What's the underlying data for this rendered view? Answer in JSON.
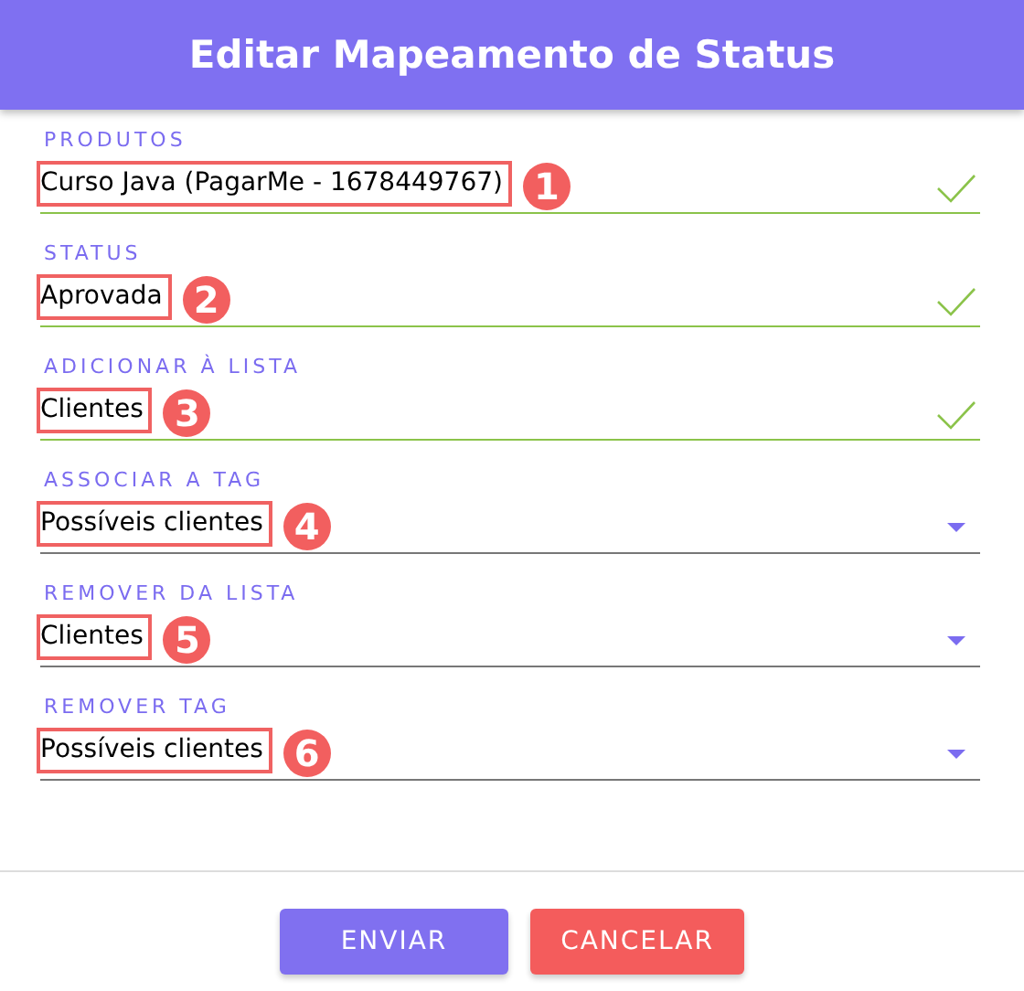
{
  "dialog": {
    "title": "Editar Mapeamento de Status"
  },
  "fields": [
    {
      "label": "PRODUTOS",
      "value": "Curso Java (PagarMe - 1678449767)",
      "kind": "valid",
      "marker": "1"
    },
    {
      "label": "STATUS",
      "value": "Aprovada",
      "kind": "valid",
      "marker": "2"
    },
    {
      "label": "ADICIONAR À LISTA",
      "value": "Clientes",
      "kind": "valid",
      "marker": "3"
    },
    {
      "label": "ASSOCIAR A TAG",
      "value": "Possíveis clientes",
      "kind": "select",
      "marker": "4"
    },
    {
      "label": "REMOVER DA LISTA",
      "value": "Clientes",
      "kind": "select",
      "marker": "5"
    },
    {
      "label": "REMOVER TAG",
      "value": "Possíveis clientes",
      "kind": "select",
      "marker": "6"
    }
  ],
  "buttons": [
    {
      "label": "ENVIAR",
      "kind": "primary"
    },
    {
      "label": "CANCELAR",
      "kind": "danger"
    }
  ]
}
